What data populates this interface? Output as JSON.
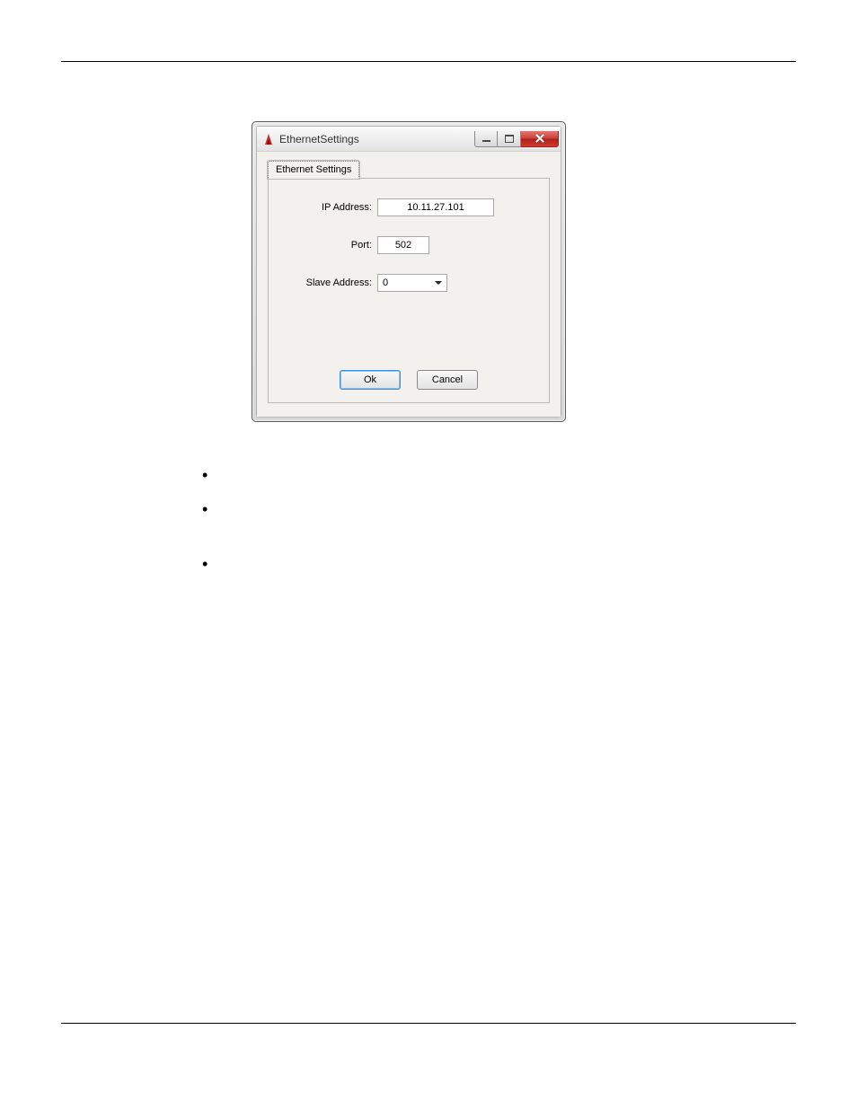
{
  "window": {
    "title": "EthernetSettings",
    "buttons": {
      "min": "Minimize",
      "max": "Maximize",
      "close": "Close"
    }
  },
  "tab": {
    "label": "Ethernet Settings"
  },
  "fields": {
    "ip": {
      "label": "IP Address:",
      "value": "10.11.27.101"
    },
    "port": {
      "label": "Port:",
      "value": "502"
    },
    "slave": {
      "label": "Slave Address:",
      "value": "0"
    }
  },
  "buttons": {
    "ok": "Ok",
    "cancel": "Cancel"
  }
}
